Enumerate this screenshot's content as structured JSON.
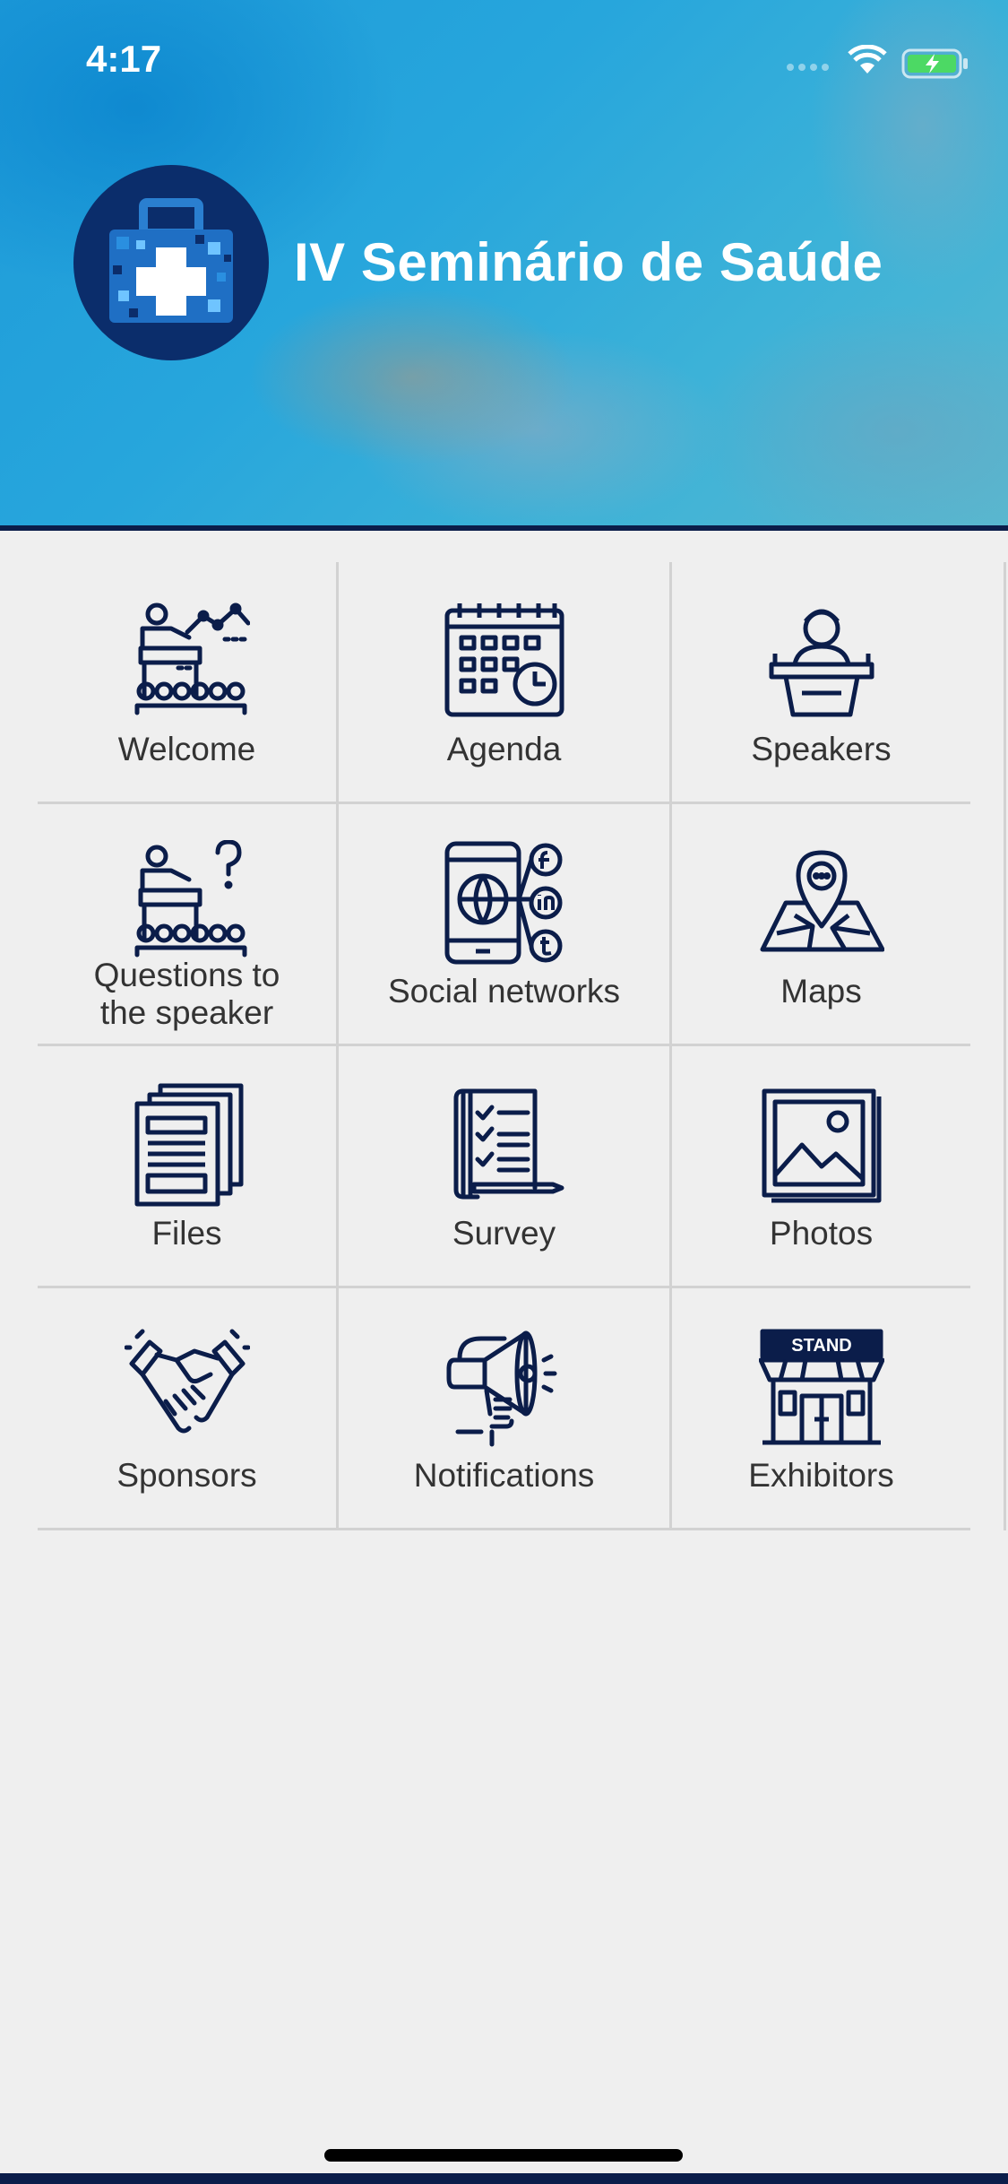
{
  "status_bar": {
    "time": "4:17"
  },
  "header": {
    "title": "IV Seminário de Saúde"
  },
  "menu": [
    {
      "label": "Welcome",
      "icon": "presentation-icon"
    },
    {
      "label": "Agenda",
      "icon": "calendar-icon"
    },
    {
      "label": "Speakers",
      "icon": "speaker-podium-icon"
    },
    {
      "label": "Questions to the speaker",
      "icon": "question-audience-icon"
    },
    {
      "label": "Social networks",
      "icon": "social-phone-icon"
    },
    {
      "label": "Maps",
      "icon": "map-pin-icon"
    },
    {
      "label": "Files",
      "icon": "files-icon"
    },
    {
      "label": "Survey",
      "icon": "survey-clipboard-icon"
    },
    {
      "label": "Photos",
      "icon": "photo-gallery-icon"
    },
    {
      "label": "Sponsors",
      "icon": "handshake-icon"
    },
    {
      "label": "Notifications",
      "icon": "megaphone-icon"
    },
    {
      "label": "Exhibitors",
      "icon": "stand-storefront-icon"
    }
  ],
  "stand_sign": "STAND",
  "colors": {
    "icon": "#0b1d4a",
    "brand_dark": "#0b2d6b",
    "header_bar": "#0b1d4a",
    "battery": "#4cd964"
  }
}
